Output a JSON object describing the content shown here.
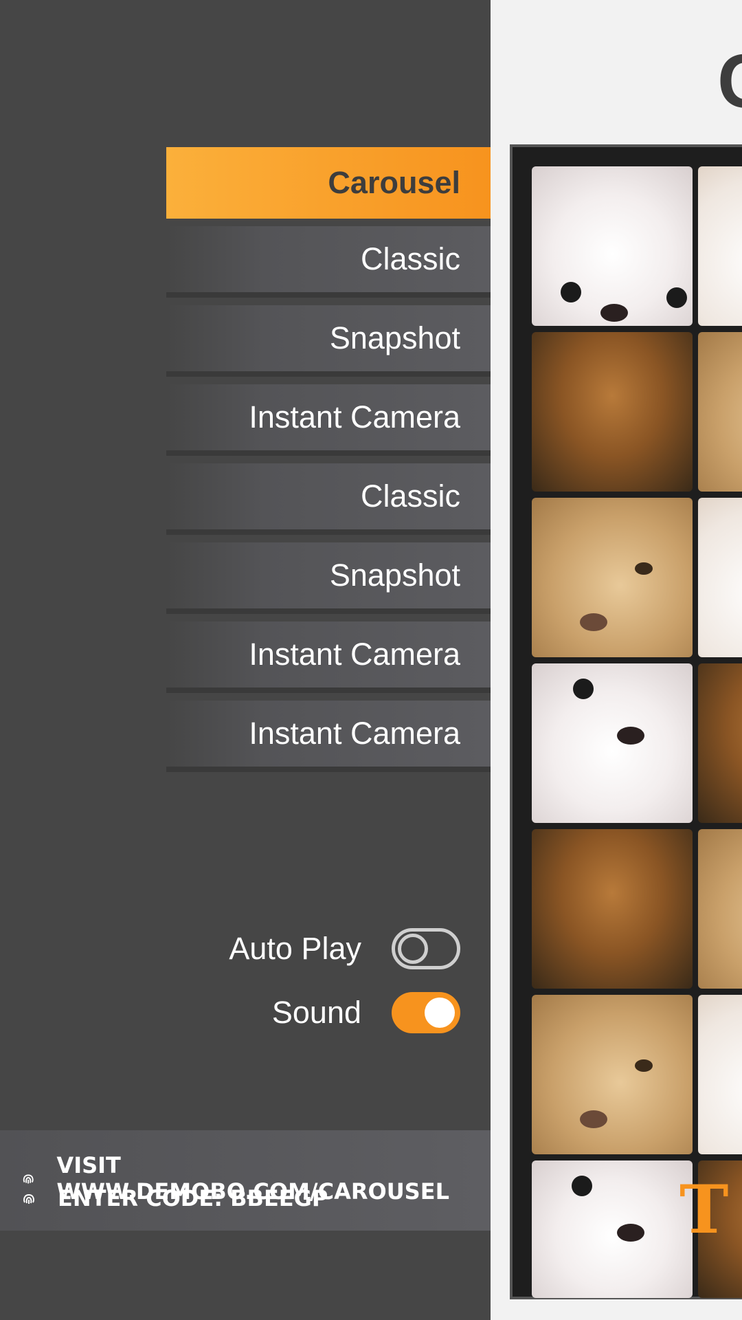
{
  "menu": {
    "items": [
      {
        "label": "Carousel",
        "active": true
      },
      {
        "label": "Classic",
        "active": false
      },
      {
        "label": "Snapshot",
        "active": false
      },
      {
        "label": "Instant Camera",
        "active": false
      },
      {
        "label": "Classic",
        "active": false
      },
      {
        "label": "Snapshot",
        "active": false
      },
      {
        "label": "Instant Camera",
        "active": false
      },
      {
        "label": "Instant Camera",
        "active": false
      }
    ]
  },
  "settings": {
    "auto_play": {
      "label": "Auto Play",
      "on": false
    },
    "sound": {
      "label": "Sound",
      "on": true
    }
  },
  "connect": {
    "visit_text": "VISIT WWW.DEMOBO.COM/CAROUSEL",
    "code_text": "ENTER CODE: BBEEGP",
    "icon": "fingerprint-icon"
  },
  "header": {
    "title_partial": "C"
  },
  "brand": {
    "mark": "T",
    "color": "#f7931e"
  },
  "colors": {
    "accent": "#f7931e",
    "sidebar_bg": "#464646",
    "page_bg": "#f2f2f2"
  }
}
